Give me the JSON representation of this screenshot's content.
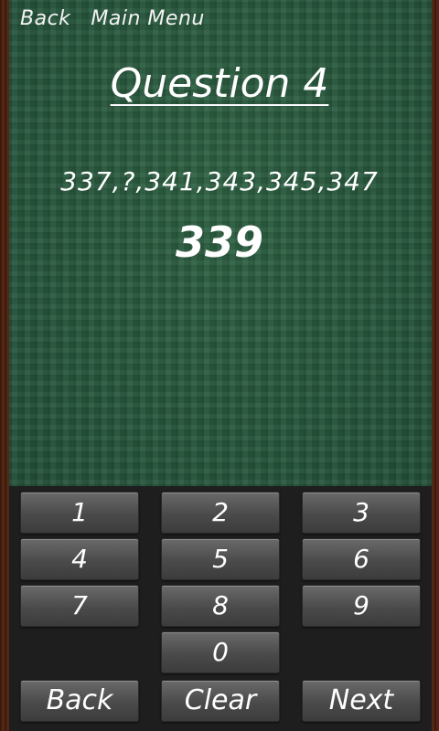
{
  "nav": {
    "back_label": "Back",
    "main_menu_label": "Main Menu"
  },
  "question": {
    "title": "Question 4",
    "sequence": "337,?,341,343,345,347",
    "answer": "339"
  },
  "keypad": {
    "digits": [
      "1",
      "2",
      "3",
      "4",
      "5",
      "6",
      "7",
      "8",
      "9",
      "0"
    ],
    "back_label": "Back",
    "clear_label": "Clear",
    "next_label": "Next"
  },
  "colors": {
    "board_green": "#2a5a3e",
    "keypad_bg": "#1e1e1e",
    "key_gray": "#555555",
    "text": "#ffffff"
  }
}
